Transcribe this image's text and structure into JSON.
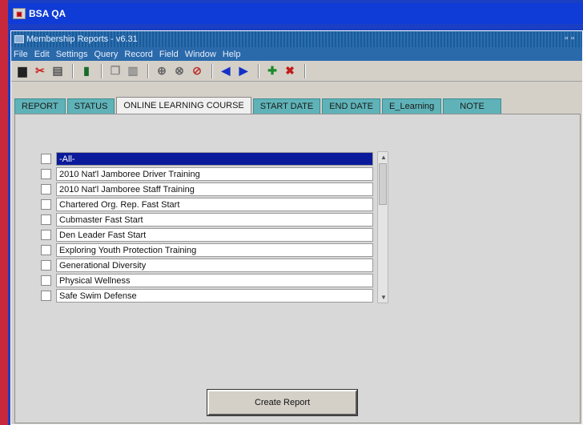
{
  "app": {
    "title": "BSA QA"
  },
  "window": {
    "title": "Membership Reports - v6.31"
  },
  "menu": [
    "File",
    "Edit",
    "Settings",
    "Query",
    "Record",
    "Field",
    "Window",
    "Help"
  ],
  "tabs": [
    "REPORT",
    "STATUS",
    "ONLINE LEARNING COURSE",
    "START DATE",
    "END DATE",
    "E_Learning",
    "NOTE"
  ],
  "active_tab": "ONLINE LEARNING COURSE",
  "courses": [
    "-All-",
    "2010 Nat'l Jamboree Driver Training",
    "2010 Nat'l Jamboree Staff Training",
    "Chartered Org. Rep. Fast Start",
    "Cubmaster Fast Start",
    "Den Leader Fast Start",
    "Exploring Youth Protection Training",
    "Generational Diversity",
    "Physical Wellness",
    "Safe Swim Defense"
  ],
  "button": {
    "create_report": "Create Report"
  }
}
